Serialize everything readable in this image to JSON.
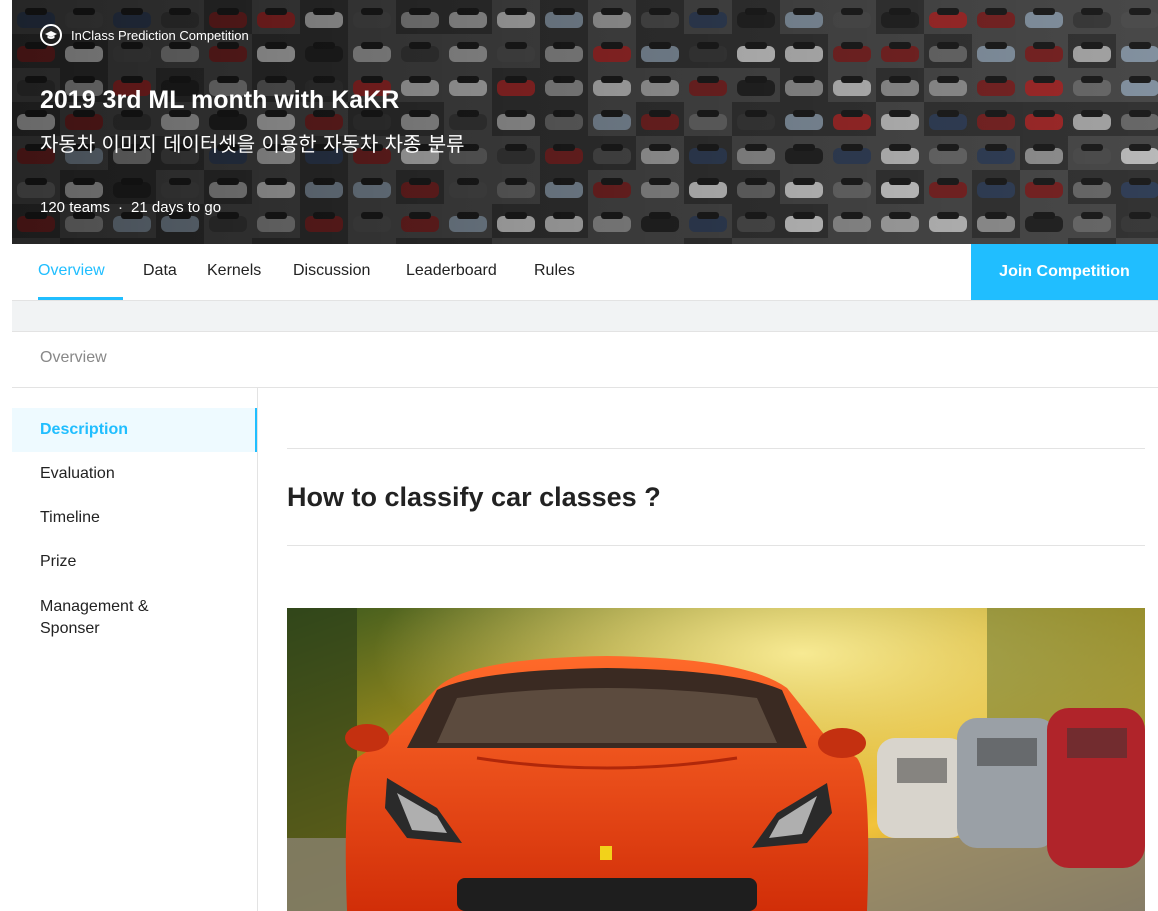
{
  "banner": {
    "badge_icon": "graduation-cap-icon",
    "badge_text": "InClass Prediction Competition",
    "title": "2019 3rd ML month with KaKR",
    "subtitle": "자동차 이미지 데이터셋을 이용한 자동차 차종 분류",
    "teams": "120 teams",
    "separator": "·",
    "deadline": "21 days to go"
  },
  "tabs": [
    {
      "label": "Overview",
      "active": true
    },
    {
      "label": "Data"
    },
    {
      "label": "Kernels"
    },
    {
      "label": "Discussion"
    },
    {
      "label": "Leaderboard"
    },
    {
      "label": "Rules"
    }
  ],
  "join_button": "Join Competition",
  "section_title": "Overview",
  "sidebar": {
    "items": [
      {
        "label": "Description",
        "active": true
      },
      {
        "label": "Evaluation"
      },
      {
        "label": "Timeline"
      },
      {
        "label": "Prize"
      },
      {
        "label": "Management & Sponser"
      }
    ]
  },
  "content": {
    "heading": "How to classify car classes ?"
  },
  "colors": {
    "accent": "#20beff",
    "car_red": "#e8380f"
  }
}
